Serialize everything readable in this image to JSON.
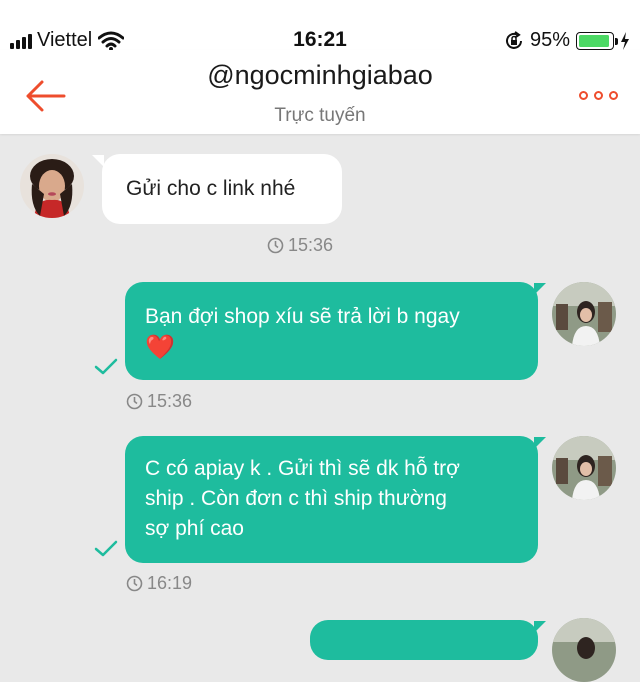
{
  "status_bar": {
    "carrier": "Viettel",
    "time": "16:21",
    "battery_percent": "95%",
    "battery_level": 0.95,
    "battery_color": "#4cd964"
  },
  "header": {
    "title": "@ngocminhgiabao",
    "presence": "Trực tuyến",
    "accent_color": "#ee4d2d",
    "back_icon": "arrow-left-icon",
    "more_icon": "more-dots-icon"
  },
  "messages": [
    {
      "direction": "incoming",
      "text": "Gửi cho c link nhé",
      "time": "15:36"
    },
    {
      "direction": "outgoing",
      "line1": "Bạn đợi shop xíu sẽ trả lời b ngay",
      "emoji": "❤️",
      "time": "15:36",
      "read": true
    },
    {
      "direction": "outgoing",
      "line1": "C có apiay k . Gửi thì sẽ dk hỗ trợ",
      "line2": "ship . Còn đơn c thì ship thường",
      "line3": "sợ phí cao",
      "time": "16:19",
      "read": true
    }
  ],
  "colors": {
    "outgoing_bubble": "#1ebc9e",
    "incoming_bubble": "#ffffff",
    "background": "#e9e9e9"
  }
}
